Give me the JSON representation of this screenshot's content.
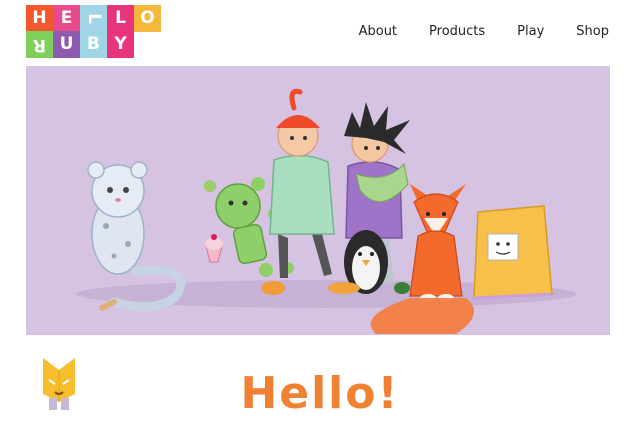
{
  "logo": {
    "tiles": [
      {
        "char": "H",
        "color": "#f2582b"
      },
      {
        "char": "E",
        "color": "#e94b8a"
      },
      {
        "char": "L",
        "color": "#a2d4e8"
      },
      {
        "char": "L",
        "color": "#e8347a"
      },
      {
        "char": "O",
        "color": "#f5b83c"
      },
      {
        "char": "R",
        "color": "#7fcf5a"
      },
      {
        "char": "U",
        "color": "#8d5ab0"
      },
      {
        "char": "B",
        "color": "#9fd6e6"
      },
      {
        "char": "Y",
        "color": "#e8347a"
      }
    ]
  },
  "nav": {
    "items": [
      {
        "label": "About"
      },
      {
        "label": "Products"
      },
      {
        "label": "Play"
      },
      {
        "label": "Shop"
      }
    ]
  },
  "hero": {
    "background": "#d6c3e2",
    "illustration": "hello-ruby-characters"
  },
  "section": {
    "mascot_icon": "ruby-mascot-icon",
    "headline": "Hello!"
  }
}
